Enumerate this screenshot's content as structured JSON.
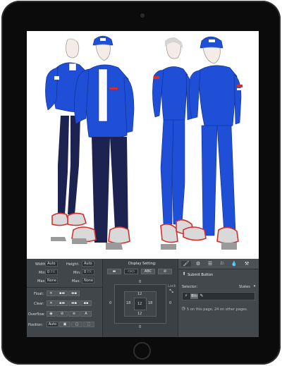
{
  "device": {
    "camera_icon": "camera-icon",
    "home_icon": "home-button-icon"
  },
  "artwork": {
    "colors": {
      "primary_blue": "#1f4fd6",
      "navy": "#1c2350",
      "red_accent": "#d32f2f",
      "white": "#ffffff",
      "sneaker_gray": "#9a9a9a"
    },
    "figures": [
      "figure-jacket-female",
      "figure-jacket-male",
      "figure-athletic-female",
      "figure-athletic-male"
    ]
  },
  "layout_panel": {
    "width_label": "Width:",
    "width_value": "Auto",
    "height_label": "Height:",
    "height_value": "Auto",
    "min_label": "Min:",
    "min_w_value": "0",
    "min_w_unit": "PX",
    "min_h_value": "0",
    "min_h_unit": "PX",
    "max_label": "Max:",
    "max_w_value": "None",
    "max_h_value": "None",
    "float_label": "Float:",
    "clear_label": "Clear:",
    "overflow_label": "Overflow:",
    "position_label": "Position:",
    "position_value": "Auto"
  },
  "display_panel": {
    "title": "Display Setting:",
    "display_options": [
      "block",
      "inline-block",
      "inline",
      "none"
    ],
    "margin_values": {
      "top": "0",
      "right": "0",
      "bottom": "0",
      "left": "0"
    },
    "padding_values": {
      "top": "12",
      "right": "18",
      "bottom": "12",
      "left": "18"
    },
    "center_value": "12",
    "lock_label": "Lock"
  },
  "selector_panel": {
    "tabs": [
      "brush-icon",
      "gear-icon",
      "list-icon",
      "interactions-icon",
      "drops-icon",
      "settings-group-icon"
    ],
    "element_label": "Submit Button",
    "selector_label": "Selector:",
    "states_label": "States",
    "tag": "Btn",
    "footer_text": "5 on this page, 24 on other pages."
  }
}
